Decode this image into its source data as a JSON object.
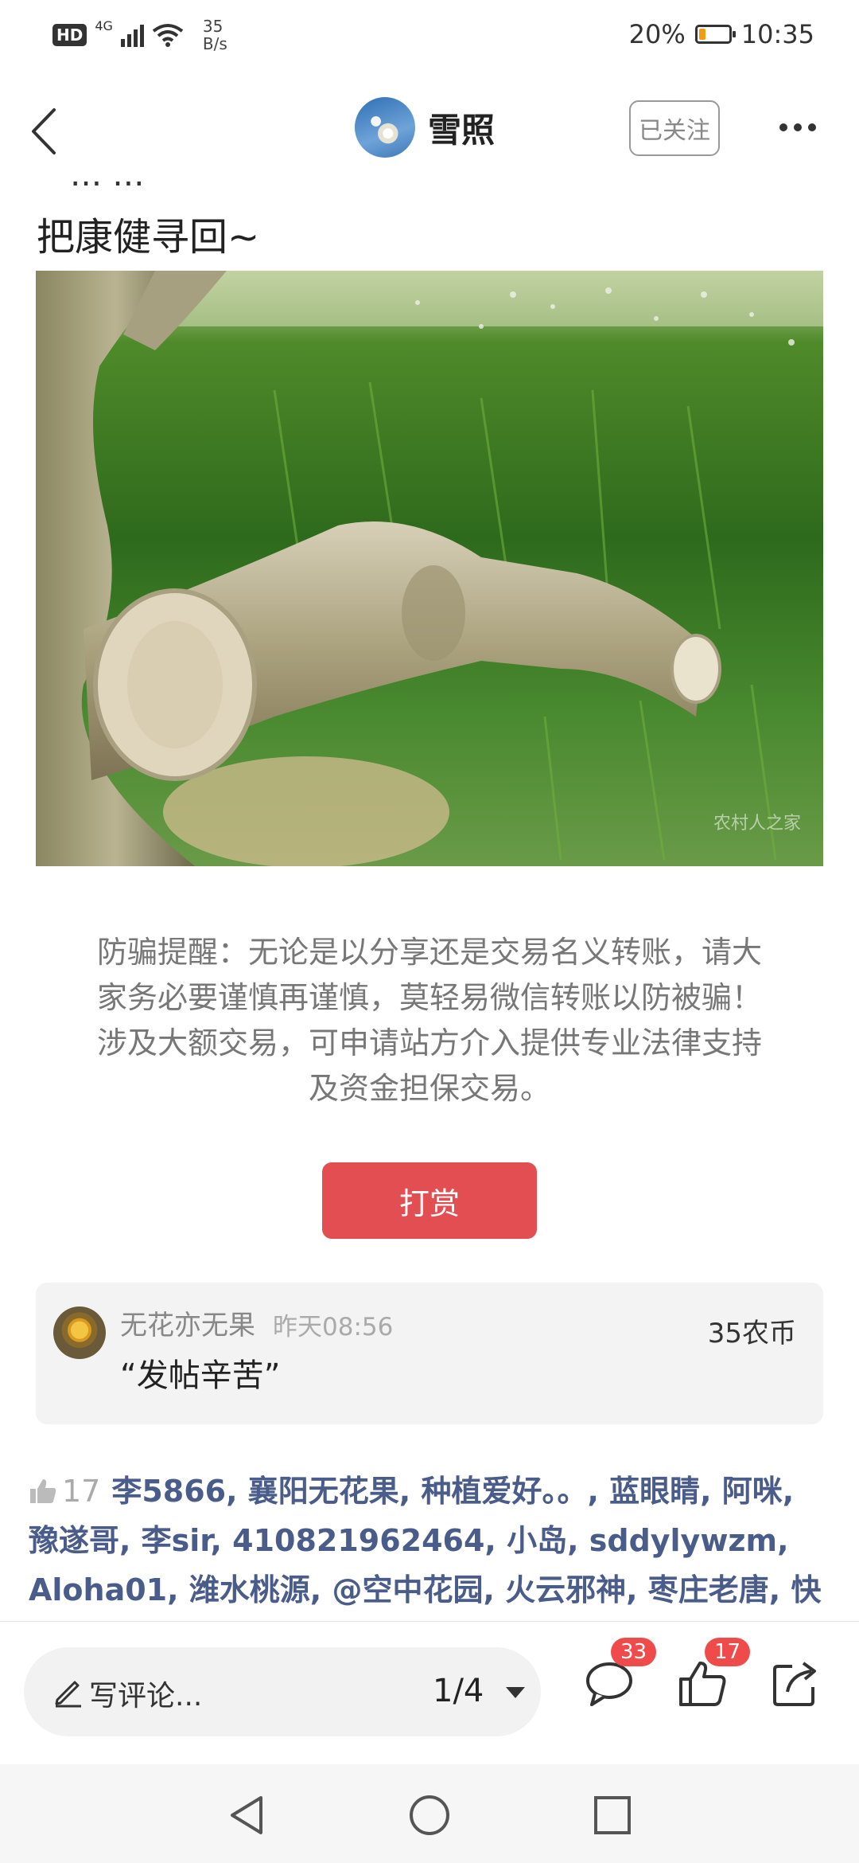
{
  "status_bar": {
    "hd": "HD",
    "network": "4G",
    "speed_value": "35",
    "speed_unit": "B/s",
    "battery": "20%",
    "time": "10:35"
  },
  "nav": {
    "username": "雪照",
    "follow_label": "已关注"
  },
  "post": {
    "cut_line": "... ...",
    "title": "把康健寻回~",
    "image_watermark": "农村人之家",
    "anti_fraud_notice": "防骗提醒：无论是以分享还是交易名义转账，请大家务必要谨慎再谨慎，莫轻易微信转账以防被骗！涉及大额交易，可申请站方介入提供专业法律支持及资金担保交易。",
    "reward_button": "打赏"
  },
  "reward_record": {
    "name": "无花亦无果",
    "time": "昨天08:56",
    "message": "“发帖辛苦”",
    "amount": "35农币"
  },
  "likes": {
    "count": "17",
    "names": "李5866, 襄阳无花果, 种植爱好。。, 蓝眼睛, 阿咪, 豫遂哥, 李sir, 410821962464, 小岛, sddylywzm, Aloha01, 潍水桃源, @空中花园, 火云邪神, 枣庄老唐, 快乐小羊, 李哥哥"
  },
  "action_bar": {
    "comment_placeholder": "写评论...",
    "pager": "1/4",
    "comment_count": "33",
    "like_count": "17"
  },
  "icons": [
    "back-icon",
    "more-icon",
    "pen-icon",
    "comment-icon",
    "like-icon",
    "share-icon",
    "nav-back-icon",
    "nav-home-icon",
    "nav-recents-icon"
  ]
}
